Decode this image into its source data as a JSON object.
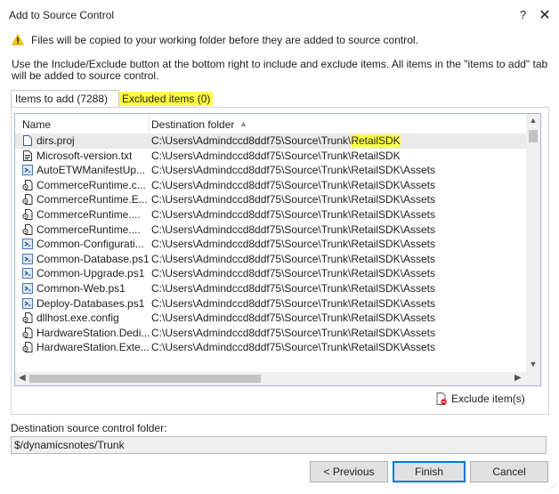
{
  "window": {
    "title": "Add to Source Control",
    "help_label": "?",
    "close_label": "✕"
  },
  "warning": {
    "text": "Files will be copied to your working folder before they are added to source control."
  },
  "instructions": "Use the Include/Exclude button at the bottom right to include and exclude items. All items in the \"items to add\" tab will be added to source control.",
  "tabs": {
    "items_to_add": "Items to add (7288)",
    "excluded_items": "Excluded items (0)"
  },
  "list": {
    "columns": {
      "name": "Name",
      "destination": "Destination folder"
    },
    "rows": [
      {
        "icon": "file-icon",
        "name": "dirs.proj",
        "dest_prefix": "C:\\Users\\Admindccd8ddf75\\Source\\Trunk\\",
        "dest_highlight": "RetailSDK",
        "dest_suffix": "",
        "selected": true
      },
      {
        "icon": "text-file-icon",
        "name": "Microsoft-version.txt",
        "dest_prefix": "C:\\Users\\Admindccd8ddf75\\Source\\Trunk\\RetailSDK",
        "dest_highlight": "",
        "dest_suffix": "",
        "selected": false
      },
      {
        "icon": "powershell-icon",
        "name": "AutoETWManifestUp...",
        "dest_prefix": "C:\\Users\\Admindccd8ddf75\\Source\\Trunk\\RetailSDK\\Assets",
        "dest_highlight": "",
        "dest_suffix": "",
        "selected": false
      },
      {
        "icon": "config-file-icon",
        "name": "CommerceRuntime.c...",
        "dest_prefix": "C:\\Users\\Admindccd8ddf75\\Source\\Trunk\\RetailSDK\\Assets",
        "dest_highlight": "",
        "dest_suffix": "",
        "selected": false
      },
      {
        "icon": "config-file-icon",
        "name": "CommerceRuntime.E...",
        "dest_prefix": "C:\\Users\\Admindccd8ddf75\\Source\\Trunk\\RetailSDK\\Assets",
        "dest_highlight": "",
        "dest_suffix": "",
        "selected": false
      },
      {
        "icon": "config-file-icon",
        "name": "CommerceRuntime....",
        "dest_prefix": "C:\\Users\\Admindccd8ddf75\\Source\\Trunk\\RetailSDK\\Assets",
        "dest_highlight": "",
        "dest_suffix": "",
        "selected": false
      },
      {
        "icon": "config-file-icon",
        "name": "CommerceRuntime....",
        "dest_prefix": "C:\\Users\\Admindccd8ddf75\\Source\\Trunk\\RetailSDK\\Assets",
        "dest_highlight": "",
        "dest_suffix": "",
        "selected": false
      },
      {
        "icon": "powershell-icon",
        "name": "Common-Configurati...",
        "dest_prefix": "C:\\Users\\Admindccd8ddf75\\Source\\Trunk\\RetailSDK\\Assets",
        "dest_highlight": "",
        "dest_suffix": "",
        "selected": false
      },
      {
        "icon": "powershell-icon",
        "name": "Common-Database.ps1",
        "dest_prefix": "C:\\Users\\Admindccd8ddf75\\Source\\Trunk\\RetailSDK\\Assets",
        "dest_highlight": "",
        "dest_suffix": "",
        "selected": false
      },
      {
        "icon": "powershell-icon",
        "name": "Common-Upgrade.ps1",
        "dest_prefix": "C:\\Users\\Admindccd8ddf75\\Source\\Trunk\\RetailSDK\\Assets",
        "dest_highlight": "",
        "dest_suffix": "",
        "selected": false
      },
      {
        "icon": "powershell-icon",
        "name": "Common-Web.ps1",
        "dest_prefix": "C:\\Users\\Admindccd8ddf75\\Source\\Trunk\\RetailSDK\\Assets",
        "dest_highlight": "",
        "dest_suffix": "",
        "selected": false
      },
      {
        "icon": "powershell-icon",
        "name": "Deploy-Databases.ps1",
        "dest_prefix": "C:\\Users\\Admindccd8ddf75\\Source\\Trunk\\RetailSDK\\Assets",
        "dest_highlight": "",
        "dest_suffix": "",
        "selected": false
      },
      {
        "icon": "config-file-icon",
        "name": "dllhost.exe.config",
        "dest_prefix": "C:\\Users\\Admindccd8ddf75\\Source\\Trunk\\RetailSDK\\Assets",
        "dest_highlight": "",
        "dest_suffix": "",
        "selected": false
      },
      {
        "icon": "config-file-icon",
        "name": "HardwareStation.Dedi...",
        "dest_prefix": "C:\\Users\\Admindccd8ddf75\\Source\\Trunk\\RetailSDK\\Assets",
        "dest_highlight": "",
        "dest_suffix": "",
        "selected": false
      },
      {
        "icon": "config-file-icon",
        "name": "HardwareStation.Exte...",
        "dest_prefix": "C:\\Users\\Admindccd8ddf75\\Source\\Trunk\\RetailSDK\\Assets",
        "dest_highlight": "",
        "dest_suffix": "",
        "selected": false
      }
    ]
  },
  "exclude_button": "Exclude item(s)",
  "destination": {
    "label": "Destination source control folder:",
    "value": "$/dynamicsnotes/Trunk"
  },
  "buttons": {
    "previous": "< Previous",
    "finish": "Finish",
    "cancel": "Cancel"
  },
  "colors": {
    "highlight": "#ffff3f",
    "selected_row": "#eaeaea",
    "warning": "#f2c811",
    "default_button_border": "#0078d7"
  }
}
